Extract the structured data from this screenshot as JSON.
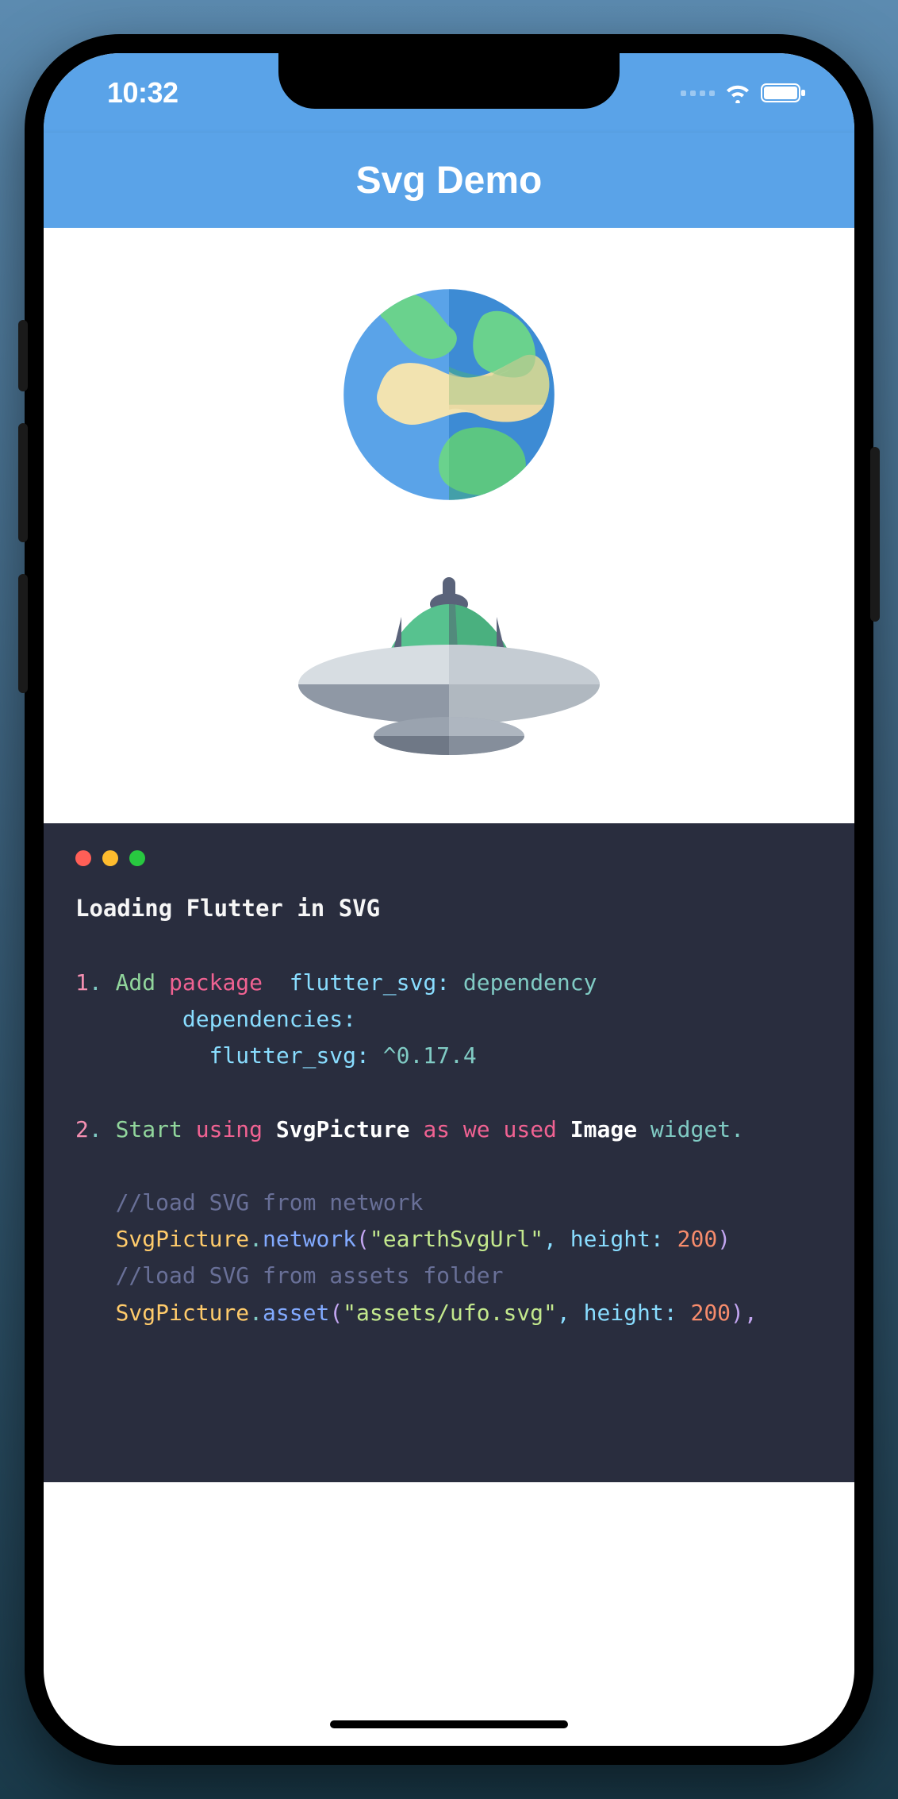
{
  "status": {
    "time": "10:32"
  },
  "app": {
    "title": "Svg Demo"
  },
  "icons": {
    "earth": "earth-icon",
    "ufo": "ufo-icon"
  },
  "code": {
    "title": "Loading Flutter in SVG",
    "n1": "1",
    "l1_add": "Add",
    "l1_package": "package",
    "l1_fluttersvg": "flutter_svg:",
    "l1_dependency": "dependency",
    "l2_dependencies": "dependencies:",
    "l3_fluttersvg": "flutter_svg:",
    "l3_version": "^0.17.4",
    "n2": "2",
    "l4_start": "Start",
    "l4_using": "using",
    "l4_svgpicture": "SvgPicture",
    "l4_as_we_used": "as we used",
    "l4_image": "Image",
    "l4_widget": "widget.",
    "c1": "//load SVG from network",
    "l5_pre": "SvgPicture",
    "l5_dot": ".",
    "l5_network": "network",
    "l5_paren_open": "(",
    "l5_str": "\"earthSvgUrl\"",
    "l5_comma_height": ", height:",
    "l5_200": " 200",
    "l5_paren_close": ")",
    "c2": "//load SVG from assets folder",
    "l6_pre": "SvgPicture",
    "l6_dot": ".",
    "l6_asset": "asset",
    "l6_paren_open": "(",
    "l6_str": "\"assets/ufo.svg\"",
    "l6_comma_height": ", height:",
    "l6_200": " 200",
    "l6_paren_close": "),"
  }
}
